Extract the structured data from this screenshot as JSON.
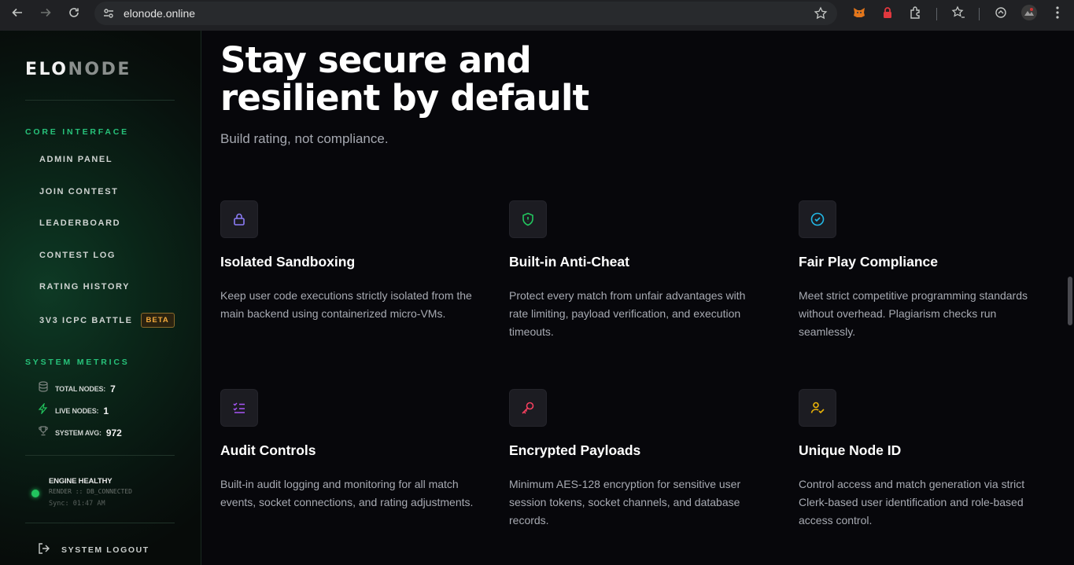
{
  "browser": {
    "url": "elonode.online"
  },
  "sidebar": {
    "logo_primary": "ELO",
    "logo_secondary": "NODE",
    "section_core": "CORE INTERFACE",
    "items": [
      {
        "label": "ADMIN PANEL"
      },
      {
        "label": "JOIN CONTEST"
      },
      {
        "label": "LEADERBOARD"
      },
      {
        "label": "CONTEST LOG"
      },
      {
        "label": "RATING HISTORY"
      },
      {
        "label": "3V3 ICPC BATTLE",
        "badge": "BETA"
      }
    ],
    "section_metrics": "SYSTEM METRICS",
    "metrics": [
      {
        "label": "TOTAL NODES:",
        "value": "7",
        "icon": "database-icon"
      },
      {
        "label": "LIVE NODES:",
        "value": "1",
        "icon": "bolt-icon"
      },
      {
        "label": "SYSTEM AVG:",
        "value": "972",
        "icon": "trophy-icon"
      }
    ],
    "status": {
      "title": "ENGINE HEALTHY",
      "sub": "RENDER :: DB_CONNECTED",
      "sync": "Sync: 01:47 AM"
    },
    "logout": "SYSTEM LOGOUT"
  },
  "main": {
    "heading": "Stay secure and resilient by default",
    "subheading": "Build rating, not compliance.",
    "cards": [
      {
        "title": "Isolated Sandboxing",
        "text": "Keep user code executions strictly isolated from the main backend using containerized micro-VMs.",
        "icon": "lock-icon",
        "color": "#8b7cf6"
      },
      {
        "title": "Built-in Anti-Cheat",
        "text": "Protect every match from unfair advantages with rate limiting, payload verification, and execution timeouts.",
        "icon": "shield-icon",
        "color": "#22c55e"
      },
      {
        "title": "Fair Play Compliance",
        "text": "Meet strict competitive programming standards without overhead. Plagiarism checks run seamlessly.",
        "icon": "check-circle-icon",
        "color": "#22b8e6"
      },
      {
        "title": "Audit Controls",
        "text": "Built-in audit logging and monitoring for all match events, socket connections, and rating adjustments.",
        "icon": "checklist-icon",
        "color": "#a855f7"
      },
      {
        "title": "Encrypted Payloads",
        "text": "Minimum AES-128 encryption for sensitive user session tokens, socket channels, and database records.",
        "icon": "key-icon",
        "color": "#f43f5e"
      },
      {
        "title": "Unique Node ID",
        "text": "Control access and match generation via strict Clerk-based user identification and role-based access control.",
        "icon": "user-check-icon",
        "color": "#eab308"
      }
    ]
  }
}
